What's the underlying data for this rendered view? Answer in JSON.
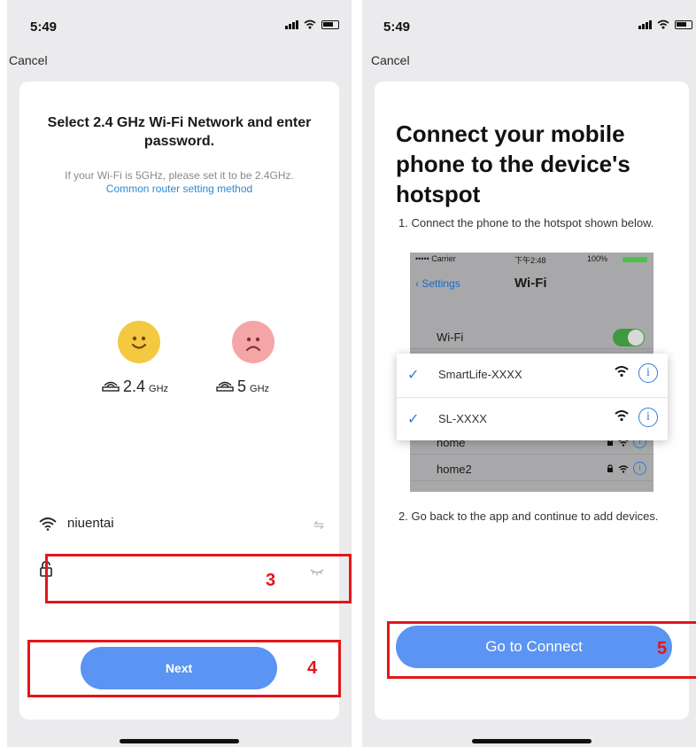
{
  "left_screen": {
    "status_time": "5:49",
    "cancel_label": "Cancel",
    "title": "Select 2.4 GHz Wi-Fi Network and enter password.",
    "hint": "If your Wi-Fi is 5GHz, please set it to be 2.4GHz.",
    "link": "Common router setting method",
    "band_ok": {
      "value": "2.4",
      "unit": "GHz",
      "icon": "happy-face-icon"
    },
    "band_bad": {
      "value": "5",
      "unit": "GHz",
      "icon": "sad-face-icon"
    },
    "wifi_name": "niuentai",
    "password_value": "",
    "next_label": "Next"
  },
  "right_screen": {
    "status_time": "5:49",
    "cancel_label": "Cancel",
    "title": "Connect your mobile phone to the device's hotspot",
    "step1": "1. Connect the phone to the hotspot shown below.",
    "mock": {
      "carrier": "••••• Carrier",
      "time": "下午2:48",
      "battery": "100%",
      "back_label": "Settings",
      "title": "Wi-Fi",
      "wifi_row_label": "Wi-Fi",
      "networks": [
        "home",
        "home2"
      ]
    },
    "popup_networks": [
      "SmartLife-XXXX",
      "SL-XXXX"
    ],
    "step2": "2. Go back to the app and continue to add devices.",
    "connect_label": "Go to Connect"
  },
  "annotations": [
    "3",
    "4",
    "5"
  ],
  "colors": {
    "accent": "#5b94f2",
    "annotation": "#e2161b",
    "link": "#2a8ad8"
  }
}
